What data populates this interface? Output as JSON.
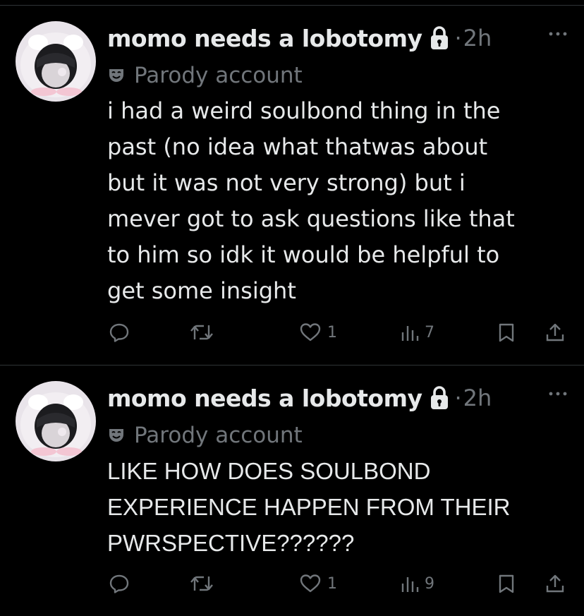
{
  "posts": [
    {
      "display_name": "momo needs a lobotomy",
      "separator": "·",
      "time": "2h",
      "account_label": "Parody account",
      "body_lines": [
        "i had a weird soulbond thing in the",
        "past (no idea what thatwas about",
        "but it was not very strong) but i",
        "mever got to ask questions like that",
        "to him so idk it would be helpful to",
        "get some insight"
      ],
      "likes": "1",
      "views": "7",
      "icons": [
        "avatar",
        "lock-icon",
        "more-icon",
        "mask-icon",
        "reply-icon",
        "repost-icon",
        "like-icon",
        "views-icon",
        "bookmark-icon",
        "share-icon"
      ]
    },
    {
      "display_name": "momo needs a lobotomy",
      "separator": "·",
      "time": "2h",
      "account_label": "Parody account",
      "body_lines": [
        "LIKE HOW DOES SOULBOND",
        "EXPERIENCE HAPPEN FROM THEIR",
        "PWRSPECTIVE??????"
      ],
      "likes": "1",
      "views": "9",
      "icons": [
        "avatar",
        "lock-icon",
        "more-icon",
        "mask-icon",
        "reply-icon",
        "repost-icon",
        "like-icon",
        "views-icon",
        "bookmark-icon",
        "share-icon"
      ]
    }
  ],
  "colors": {
    "background": "#000000",
    "text_primary": "#e7e9ea",
    "text_secondary": "#71767b",
    "divider": "#2f3336"
  }
}
